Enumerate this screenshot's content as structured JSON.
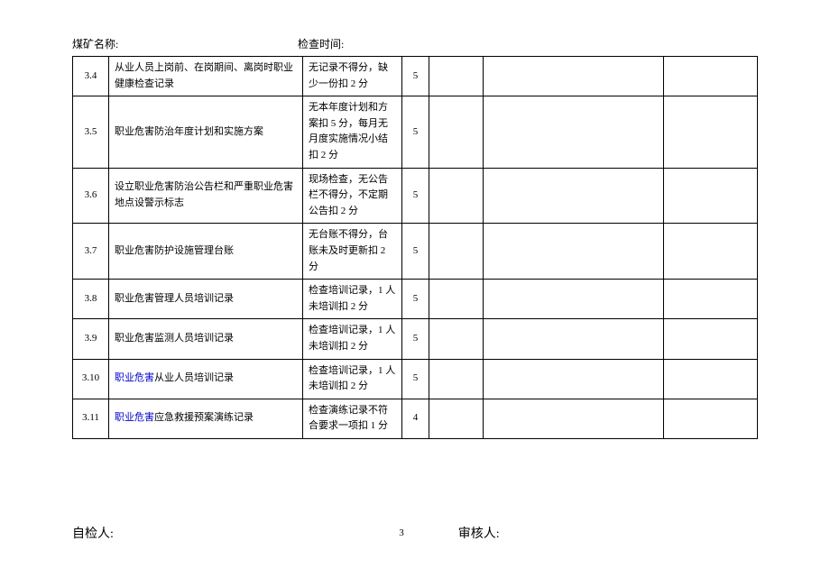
{
  "header": {
    "mine_name_label": "煤矿名称:",
    "inspection_time_label": "检查时间:"
  },
  "rows": [
    {
      "num": "3.4",
      "desc_prefix": "",
      "desc": "从业人员上岗前、在岗期间、离岗时职业健康检查记录",
      "criteria": "无记录不得分，缺少一份扣 2 分",
      "score": "5"
    },
    {
      "num": "3.5",
      "desc_prefix": "",
      "desc": "职业危害防治年度计划和实施方案",
      "criteria": "无本年度计划和方案扣 5 分，每月无月度实施情况小结扣 2 分",
      "score": "5"
    },
    {
      "num": "3.6",
      "desc_prefix": "",
      "desc": "设立职业危害防治公告栏和严重职业危害地点设警示标志",
      "criteria": "现场检查，无公告栏不得分，不定期公告扣 2 分",
      "score": "5"
    },
    {
      "num": "3.7",
      "desc_prefix": "",
      "desc": "职业危害防护设施管理台账",
      "criteria": "无台账不得分，台账未及时更新扣 2 分",
      "score": "5"
    },
    {
      "num": "3.8",
      "desc_prefix": "",
      "desc": "职业危害管理人员培训记录",
      "criteria": "检查培训记录，1 人未培训扣 2 分",
      "score": "5"
    },
    {
      "num": "3.9",
      "desc_prefix": "",
      "desc": "职业危害监测人员培训记录",
      "criteria": "检查培训记录，1 人未培训扣 2 分",
      "score": "5"
    },
    {
      "num": "3.10",
      "desc_prefix": "职业危害",
      "desc": "从业人员培训记录",
      "criteria": "检查培训记录，1 人未培训扣 2 分",
      "score": "5"
    },
    {
      "num": "3.11",
      "desc_prefix": "职业危害",
      "desc": "应急救援预案演练记录",
      "criteria": "检查演练记录不符合要求一项扣 1 分",
      "score": "4"
    }
  ],
  "footer": {
    "inspector_label": "自检人:",
    "reviewer_label": "审核人:",
    "page_number": "3"
  }
}
